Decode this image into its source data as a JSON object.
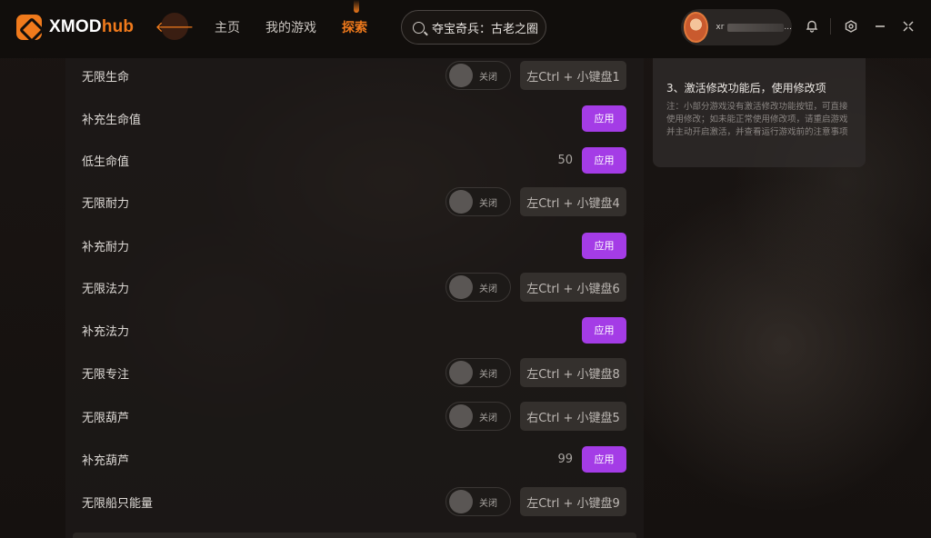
{
  "app": {
    "logo_main": "XMOD",
    "logo_accent": "hub",
    "back_glyph": "🡐"
  },
  "nav": {
    "home": "主页",
    "my_games": "我的游戏",
    "explore": "探索"
  },
  "search": {
    "value": "夺宝奇兵：古老之圈"
  },
  "user": {
    "name_prefix": "xr",
    "name_suffix": "..."
  },
  "header_icons": [
    "notification-icon",
    "settings-icon",
    "minimize-icon",
    "close-icon"
  ],
  "colors": {
    "accent_orange": "#f07a1c",
    "apply_purple": "#a43ce6"
  },
  "cheats": [
    {
      "label": "无限生命",
      "type": "toggle",
      "state": "关闭",
      "hotkey": "左Ctrl + 小键盘1"
    },
    {
      "label": "补充生命值",
      "type": "apply",
      "button": "应用"
    },
    {
      "label": "低生命值",
      "type": "apply_value",
      "value": "50",
      "button": "应用"
    },
    {
      "label": "无限耐力",
      "type": "toggle",
      "state": "关闭",
      "hotkey": "左Ctrl + 小键盘4"
    },
    {
      "label": "补充耐力",
      "type": "apply",
      "button": "应用"
    },
    {
      "label": "无限法力",
      "type": "toggle",
      "state": "关闭",
      "hotkey": "左Ctrl + 小键盘6"
    },
    {
      "label": "补充法力",
      "type": "apply",
      "button": "应用"
    },
    {
      "label": "无限专注",
      "type": "toggle",
      "state": "关闭",
      "hotkey": "左Ctrl + 小键盘8"
    },
    {
      "label": "无限葫芦",
      "type": "toggle",
      "state": "关闭",
      "hotkey": "右Ctrl + 小键盘5"
    },
    {
      "label": "补充葫芦",
      "type": "apply_value",
      "value": "99",
      "button": "应用"
    },
    {
      "label": "无限船只能量",
      "type": "toggle",
      "state": "关闭",
      "hotkey": "左Ctrl + 小键盘9"
    }
  ],
  "info_card": {
    "title": "3、激活修改功能后，使用修改项",
    "note": "注：小部分游戏没有激活修改功能按钮，可直接使用修改；如未能正常使用修改项，请重启游戏并主动开启激活，并查看运行游戏前的注意事项"
  }
}
